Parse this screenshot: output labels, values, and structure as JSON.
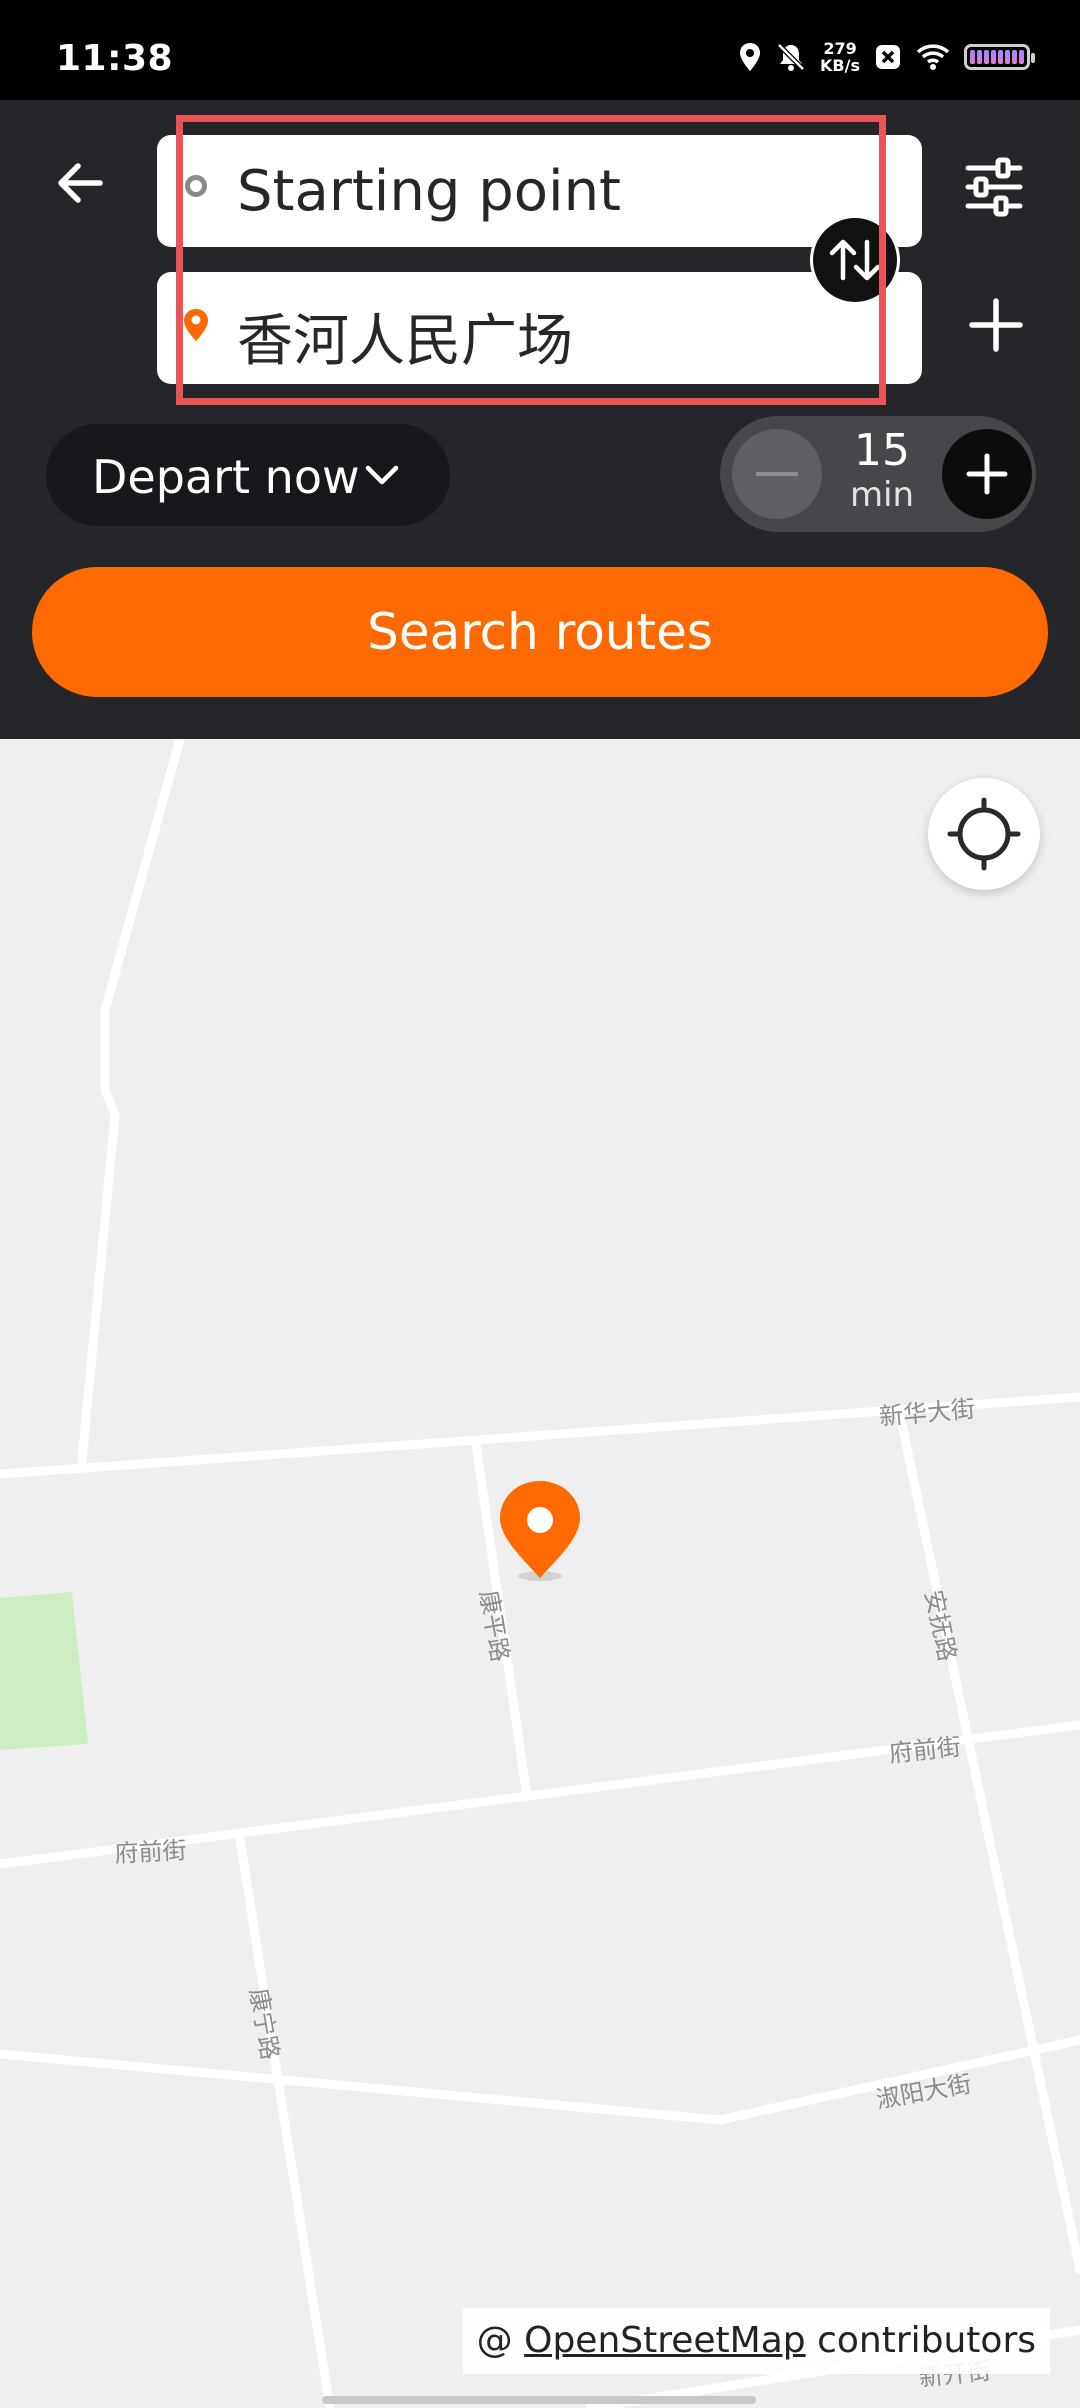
{
  "status_bar": {
    "time": "11:38",
    "network_speed_value": "279",
    "network_speed_unit": "KB/s",
    "icons": [
      "location-icon",
      "mute-icon",
      "notification-icon",
      "wifi-icon",
      "battery-icon"
    ]
  },
  "header": {
    "origin_label": "Starting point",
    "destination_label": "香河人民广场",
    "depart_label": "Depart now",
    "buffer_value": "15",
    "buffer_unit": "min",
    "search_label": "Search routes"
  },
  "map": {
    "street_labels": {
      "xinhua": "新华大街",
      "kangping": "康平路",
      "anfu": "安抚路",
      "fuqian_right": "府前街",
      "fuqian_left": "府前街",
      "kangning": "康宁路",
      "shuyang": "淑阳大街",
      "xinkai": "新开街"
    },
    "attribution_prefix": "@",
    "attribution_link": "OpenStreetMap",
    "attribution_suffix": "contributors"
  },
  "colors": {
    "accent": "#ff6a00",
    "header_bg": "#25262a",
    "highlight": "#ea5454",
    "map_bg": "#efeff0",
    "park": "#cdeec2"
  }
}
